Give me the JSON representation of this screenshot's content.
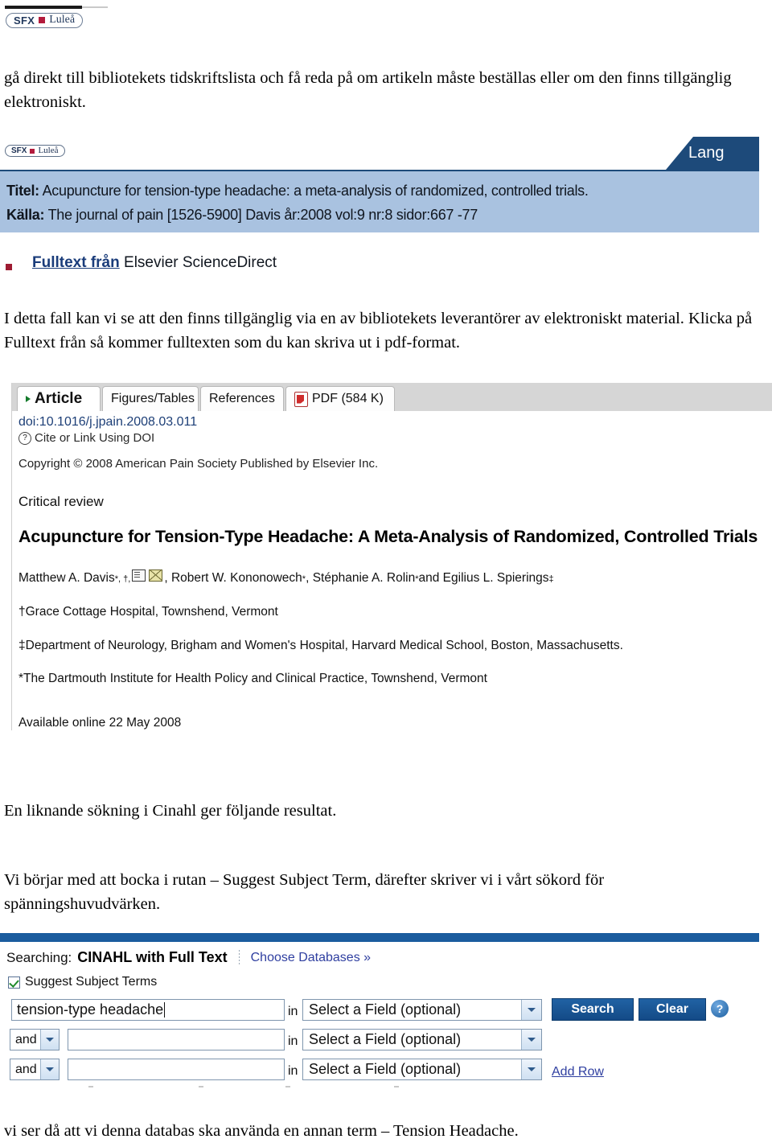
{
  "document": {
    "paragraphs": {
      "intro": "gå direkt till bibliotekets tidskriftslista och få reda på om artikeln måste beställas eller om den finns tillgänglig elektroniskt.",
      "fulltext": "I detta fall kan vi se att den finns tillgänglig via en av bibliotekets leverantörer av elektroniskt material. Klicka på Fulltext från så kommer fulltexten som du kan skriva ut i pdf-format.",
      "cinahl": "En liknande sökning i Cinahl ger följande resultat.",
      "suggest": "Vi börjar med att bocka i rutan –  Suggest Subject Term, därefter skriver vi i vårt  sökord för spänningshuvudvärken.",
      "final": "vi ser då att vi denna databas ska använda en annan term – Tension Headache."
    }
  },
  "sfx_header_logo": {
    "word": "SFX",
    "city": "Luleå"
  },
  "sfx_result": {
    "logo": {
      "word": "SFX",
      "city": "Luleå"
    },
    "language_tab": "Lang",
    "title_label": "Titel:",
    "title_value": "Acupuncture for tension-type headache: a meta-analysis of randomized, controlled trials.",
    "source_label": "Källa:",
    "source_value": "The journal of pain [1526-5900] Davis år:2008 vol:9 nr:8 sidor:667 -77",
    "fulltext_link": "Fulltext från",
    "fulltext_provider": "Elsevier ScienceDirect"
  },
  "sciencedirect": {
    "tabs": [
      {
        "label": "Article",
        "active": true
      },
      {
        "label": "Figures/Tables",
        "active": false
      },
      {
        "label": "References",
        "active": false
      },
      {
        "label": "PDF (584 K)",
        "active": false
      }
    ],
    "doi": "doi:10.1016/j.jpain.2008.03.011",
    "cite_link": "Cite or Link Using DOI",
    "copyright": "Copyright © 2008 American Pain Society Published by Elsevier Inc.",
    "kicker": "Critical review",
    "article_title": "Acupuncture for Tension-Type Headache: A Meta-Analysis of Randomized, Controlled Trials",
    "authors": {
      "a1_name": "Matthew A. Davis",
      "a1_marks": "*, †,",
      "a2": ", Robert W. Kononowech",
      "a2_mark": "*",
      "a3": ", Stéphanie A. Rolin",
      "a3_mark": "*",
      "a4": " and Egilius L. Spierings",
      "a4_mark": "‡"
    },
    "affiliations": [
      "†Grace Cottage Hospital, Townshend, Vermont",
      "‡Department of Neurology, Brigham and Women's Hospital, Harvard Medical School, Boston, Massachusetts.",
      "*The Dartmouth Institute for Health Policy and Clinical Practice, Townshend, Vermont"
    ],
    "available_online": "Available online 22 May 2008"
  },
  "cinahl": {
    "searching_label": "Searching:",
    "database": "CINAHL with Full Text",
    "choose_databases": "Choose Databases »",
    "suggest_subject_terms": "Suggest Subject Terms",
    "suggest_checked": true,
    "rows": [
      {
        "bool": "",
        "term": "tension-type headache",
        "in_label": "in",
        "field": "Select a Field (optional)"
      },
      {
        "bool": "and",
        "term": "",
        "in_label": "in",
        "field": "Select a Field (optional)"
      },
      {
        "bool": "and",
        "term": "",
        "in_label": "in",
        "field": "Select a Field (optional)"
      }
    ],
    "search_button": "Search",
    "clear_button": "Clear",
    "help_glyph": "?",
    "add_row": "Add Row"
  },
  "colors": {
    "sfx_band": "#a9c2e0",
    "sfx_navy": "#1d4a7a",
    "cinahl_blue": "#1b5c9e",
    "link_blue": "#2f3fa0",
    "accent_red": "#b31b3c"
  }
}
